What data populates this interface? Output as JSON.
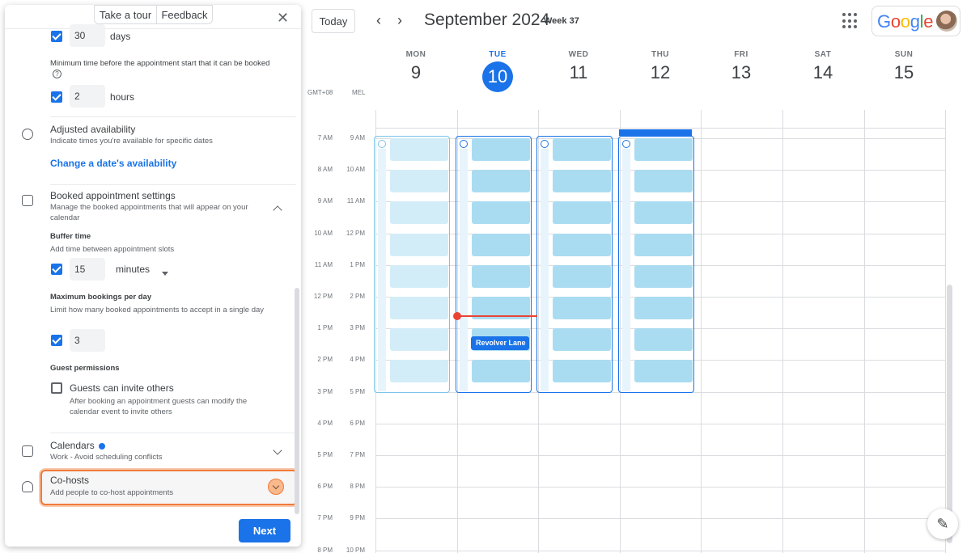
{
  "header": {
    "today_label": "Today",
    "prev_icon": "chevron-left-icon",
    "next_icon": "chevron-right-icon",
    "month_title": "September 2024",
    "week_label": "Week 37",
    "apps_icon": "apps-grid-icon",
    "brand": "Google"
  },
  "timezones": {
    "primary": "GMT+08",
    "secondary": "MEL"
  },
  "days": [
    {
      "name": "MON",
      "num": "9"
    },
    {
      "name": "TUE",
      "num": "10",
      "today": true
    },
    {
      "name": "WED",
      "num": "11"
    },
    {
      "name": "THU",
      "num": "12"
    },
    {
      "name": "FRI",
      "num": "13"
    },
    {
      "name": "SAT",
      "num": "14"
    },
    {
      "name": "SUN",
      "num": "15"
    }
  ],
  "times_primary": [
    "7 AM",
    "8 AM",
    "9 AM",
    "10 AM",
    "11 AM",
    "12 PM",
    "1 PM",
    "2 PM",
    "3 PM",
    "4 PM",
    "5 PM",
    "6 PM",
    "7 PM",
    "8 PM"
  ],
  "times_secondary": [
    "9 AM",
    "10 AM",
    "11 AM",
    "12 PM",
    "1 PM",
    "2 PM",
    "3 PM",
    "4 PM",
    "5 PM",
    "6 PM",
    "7 PM",
    "8 PM",
    "9 PM",
    "10 PM"
  ],
  "event": {
    "title": "Revolver Lane"
  },
  "colors": {
    "accent": "#1a73e8",
    "slot": "#aadcf1",
    "now_line": "#ea4335",
    "highlight": "#f07a3a"
  },
  "panel": {
    "tour_label": "Take a tour",
    "feedback_label": "Feedback",
    "close_icon": "close-icon",
    "max_days": {
      "checked": true,
      "value": "30",
      "unit": "days"
    },
    "min_time": {
      "label": "Minimum time before the appointment start that it can be booked",
      "checked": true,
      "value": "2",
      "unit": "hours"
    },
    "adjusted": {
      "title": "Adjusted availability",
      "subtitle": "Indicate times you're available for specific dates",
      "link": "Change a date's availability"
    },
    "booked": {
      "title": "Booked appointment settings",
      "subtitle": "Manage the booked appointments that will appear on your calendar",
      "buffer_title": "Buffer time",
      "buffer_sub": "Add time between appointment slots",
      "buffer_value": "15",
      "buffer_unit": "minutes",
      "max_title": "Maximum bookings per day",
      "max_sub": "Limit how many booked appointments to accept in a single day",
      "max_value": "3",
      "guest_title": "Guest permissions",
      "guest_label": "Guests can invite others",
      "guest_sub": "After booking an appointment guests can modify the calendar event to invite others"
    },
    "calendars": {
      "title": "Calendars",
      "subtitle": "Work - Avoid scheduling conflicts"
    },
    "cohosts": {
      "title": "Co-hosts",
      "subtitle": "Add people to co-host appointments"
    },
    "next_label": "Next"
  }
}
